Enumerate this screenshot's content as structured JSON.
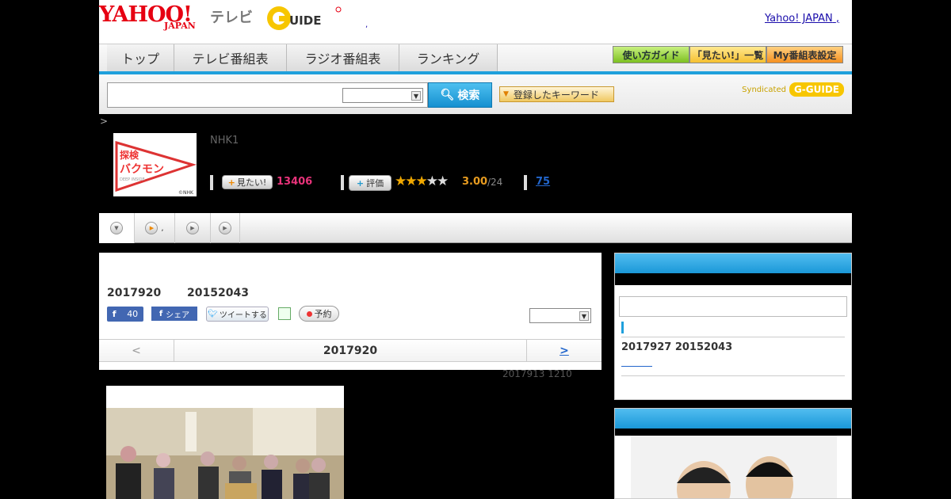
{
  "header": {
    "logo_yahoo": "YAHOO!",
    "logo_japan": "JAPAN",
    "logo_tv": "テレビ",
    "logo_gguide": "G-GUIDE",
    "dot": ",",
    "yahoo_japan_link": "Yahoo! JAPAN",
    "link_suffix": ","
  },
  "nav": {
    "items": [
      "トップ",
      "テレビ番組表",
      "ラジオ番組表",
      "ランキング"
    ],
    "right_buttons": [
      "使い方ガイド",
      "「見たい!」一覧",
      "My番組表設定"
    ]
  },
  "search": {
    "input_value": "",
    "select_value": "",
    "button_label": "検索",
    "keyword_button_label": "登録したキーワード",
    "syndicated_label": "Syndicated",
    "syndicated_logo": "G-GUIDE"
  },
  "breadcrumb": ">",
  "program": {
    "thumb_line1": "探検",
    "thumb_line2": "バクモン",
    "thumb_sub": "DEEP INSIDE",
    "thumb_credit": "©NHK",
    "channel": "NHK1",
    "want_label": "見たい!",
    "want_count": "13406",
    "rate_label": "評価",
    "stars_on": 3,
    "stars_total": 5,
    "rating": "3.00",
    "rating_count": "/24",
    "reviews": "75"
  },
  "tabs": [
    {
      "icon": "down",
      "label": ""
    },
    {
      "icon": "play",
      "label": ","
    },
    {
      "icon": "play",
      "label": ""
    },
    {
      "icon": "play",
      "label": ""
    }
  ],
  "main": {
    "episode_title": "2017920　　 20152043",
    "fb_like_count": "40",
    "fb_share_label": "シェア",
    "tweet_label": "ツイートする",
    "reserve_label": "予約",
    "select_value": "",
    "pager_prev": "<",
    "pager_date": "2017920",
    "pager_next": ">",
    "update_note": "2017913  1210"
  },
  "sidebar": {
    "box1_text": "2017927  20152043",
    "box1_input": ""
  },
  "colors": {
    "accent_blue": "#1fa0dc",
    "want_pink": "#e8337a",
    "rating_orange": "#e89c20",
    "link_blue": "#2266cc",
    "yahoo_red": "#e60012"
  }
}
